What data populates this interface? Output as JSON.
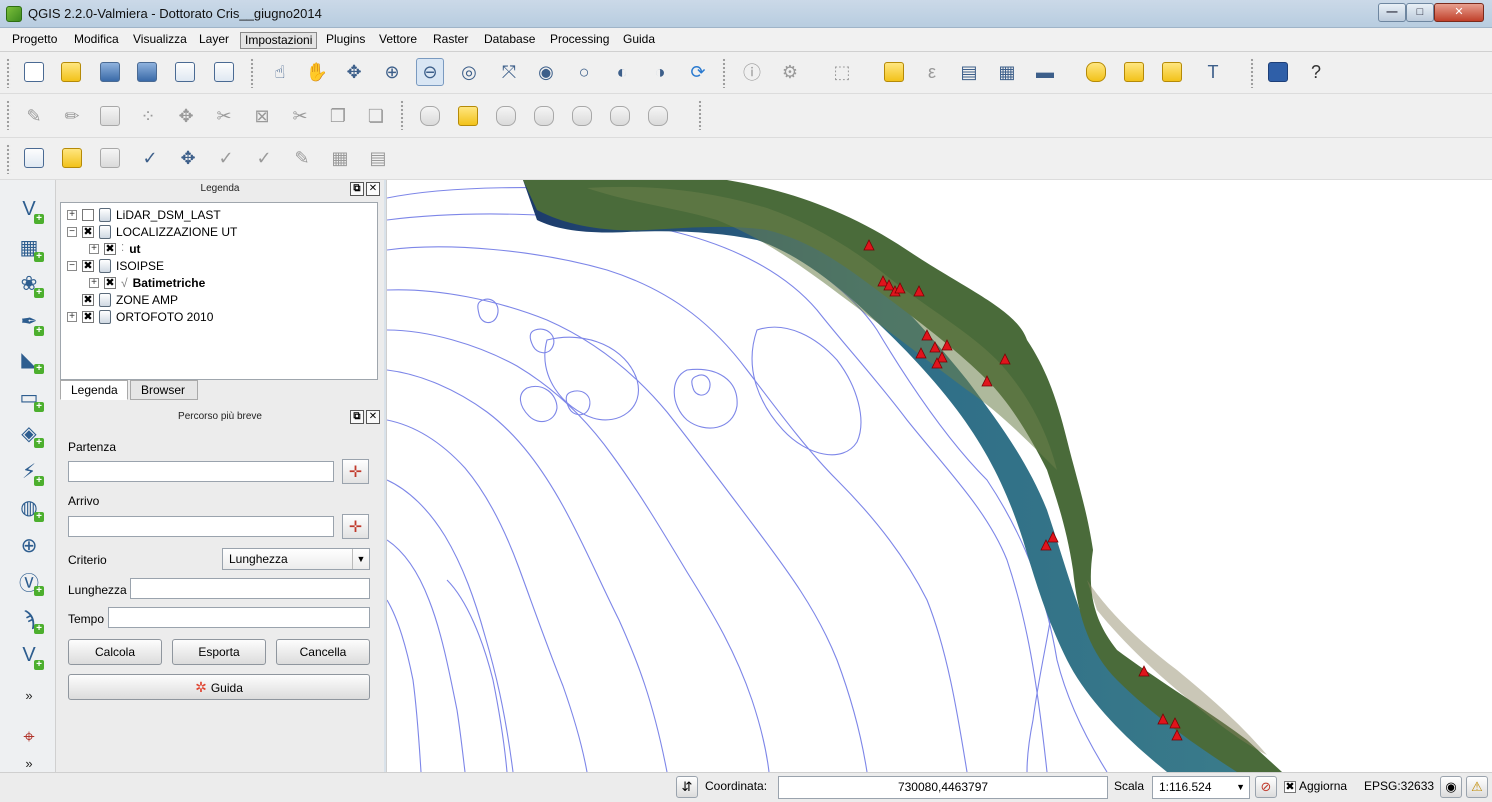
{
  "window": {
    "title": "QGIS 2.2.0-Valmiera - Dottorato Cris__giugno2014",
    "controls": {
      "minimize": "—",
      "maximize": "□",
      "close": "✕"
    }
  },
  "menubar": [
    "Progetto",
    "Modifica",
    "Visualizza",
    "Layer",
    "Impostazioni",
    "Plugins",
    "Vettore",
    "Raster",
    "Database",
    "Processing",
    "Guida"
  ],
  "active_menu": "Impostazioni",
  "toolbars": {
    "file_nav": [
      "new-project-icon",
      "open-project-icon",
      "save-project-icon",
      "save-as-icon",
      "print-composer-icon",
      "composer-manager-icon",
      "touch-zoom-icon",
      "pan-icon",
      "pan-to-selection-icon",
      "zoom-in-icon",
      "zoom-out-icon",
      "zoom-native-icon",
      "zoom-full-icon",
      "zoom-to-selection-icon",
      "zoom-to-layer-icon",
      "zoom-last-icon",
      "zoom-next-icon",
      "refresh-icon",
      "identify-icon",
      "action-icon",
      "select-icon",
      "deselect-icon",
      "expression-icon",
      "attribute-table-icon",
      "field-calculator-icon",
      "measure-icon",
      "map-tips-icon",
      "new-bookmark-icon",
      "show-bookmarks-icon",
      "text-annotation-icon",
      "help-icon",
      "whats-this-icon"
    ],
    "edit_label": [
      "current-edits-icon",
      "toggle-editing-icon",
      "save-edits-icon",
      "add-feature-icon",
      "move-feature-icon",
      "node-tool-icon",
      "delete-selected-icon",
      "cut-features-icon",
      "copy-features-icon",
      "paste-features-icon",
      "label-icon",
      "layer-labeling-icon",
      "pin-label-icon",
      "show-hide-label-icon",
      "move-label-icon",
      "rotate-label-icon",
      "change-label-icon"
    ],
    "database": [
      "db-manager-icon",
      "db-manager-add-icon",
      "db-manager-remove-icon",
      "new-shapefile-icon",
      "new-spatialite-icon",
      "new-gpx-icon",
      "merge-shapefiles-icon",
      "rename-icon",
      "grid-icon",
      "import-icon"
    ]
  },
  "left_toolbar": [
    "add-vector-layer-icon",
    "add-raster-layer-icon",
    "add-postgis-layer-icon",
    "add-spatialite-layer-icon",
    "add-mssql-layer-icon",
    "add-oracle-layer-icon",
    "add-wms-layer-icon",
    "add-wcs-layer-icon",
    "add-wfs-layer-icon",
    "add-delimited-text-icon",
    "new-shapefile-layer-icon",
    "add-gpx-layer-icon",
    "new-temp-layer-icon",
    "more-icon",
    "crs-icon",
    "more-icon"
  ],
  "legend": {
    "title": "Legenda",
    "items": [
      {
        "name": "LiDAR_DSM_LAST",
        "checked": false,
        "level": 0,
        "bold": false,
        "expand": "+"
      },
      {
        "name": "LOCALIZZAZIONE UT",
        "checked": true,
        "level": 0,
        "bold": false,
        "expand": "−"
      },
      {
        "name": "ut",
        "checked": true,
        "level": 1,
        "bold": true,
        "expand": "+"
      },
      {
        "name": "ISOIPSE",
        "checked": true,
        "level": 0,
        "bold": false,
        "expand": "−"
      },
      {
        "name": "Batimetriche",
        "checked": true,
        "level": 1,
        "bold": true,
        "expand": "+"
      },
      {
        "name": "ZONE AMP",
        "checked": true,
        "level": 0,
        "bold": false,
        "expand": ""
      },
      {
        "name": "ORTOFOTO 2010",
        "checked": true,
        "level": 0,
        "bold": false,
        "expand": "+"
      }
    ],
    "tabs": [
      "Legenda",
      "Browser"
    ],
    "selected_tab": "Legenda"
  },
  "route_panel": {
    "title": "Percorso più breve",
    "partenza_label": "Partenza",
    "partenza_value": "",
    "arrivo_label": "Arrivo",
    "arrivo_value": "",
    "criterio_label": "Criterio",
    "criterio_value": "Lunghezza",
    "lunghezza_label": "Lunghezza",
    "lunghezza_value": "",
    "tempo_label": "Tempo",
    "tempo_value": "",
    "buttons": {
      "calcola": "Calcola",
      "esporta": "Esporta",
      "cancella": "Cancella",
      "guida": "Guida"
    }
  },
  "statusbar": {
    "coord_label": "Coordinata:",
    "coord_value": "730080,4463797",
    "scale_label": "Scala",
    "scale_value": "1:116.524",
    "render_label": "Aggiorna",
    "render_checked": true,
    "crs": "EPSG:32633"
  },
  "colors": {
    "bathymetry_line": "#7d86e8",
    "ut_marker": "#e0141c",
    "land": "#4a6b3a",
    "shallow_water": "#2e6d87"
  }
}
